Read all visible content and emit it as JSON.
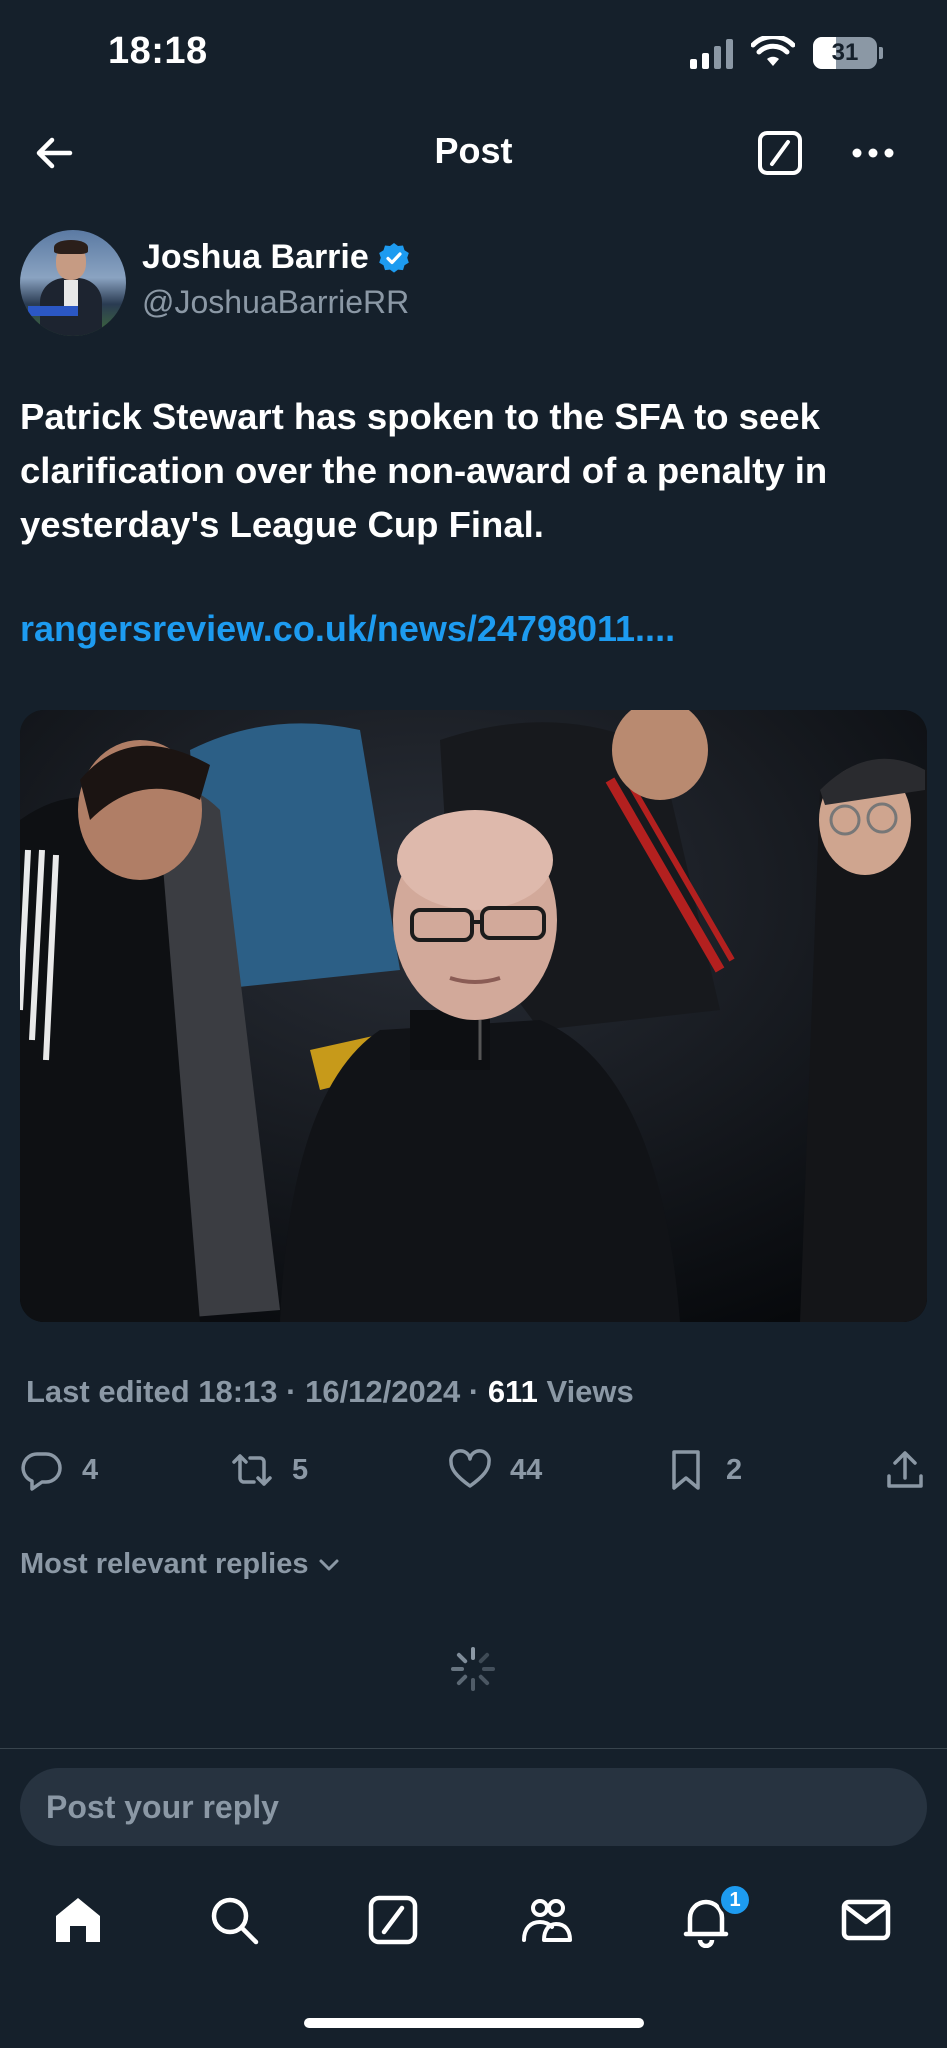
{
  "status_bar": {
    "time": "18:18",
    "battery": "31"
  },
  "header": {
    "title": "Post"
  },
  "author": {
    "name": "Joshua Barrie",
    "handle": "@JoshuaBarrieRR"
  },
  "tweet": {
    "text": "Patrick Stewart has spoken to the SFA to seek clarification over the non-award of a penalty in yesterday's League Cup Final.",
    "link": "rangersreview.co.uk/news/24798011...."
  },
  "meta": {
    "edited": "Last edited 18:13 · 16/12/2024 ·",
    "views_count": "611",
    "views_label": "Views"
  },
  "actions": {
    "replies": "4",
    "reposts": "5",
    "likes": "44",
    "bookmarks": "2"
  },
  "replies_sort": {
    "label": "Most relevant replies"
  },
  "reply_box": {
    "placeholder": "Post your reply"
  },
  "tab_bar": {
    "notifications_badge": "1"
  },
  "icons": [
    "back-arrow-icon",
    "compose-icon",
    "more-icon",
    "verified-icon",
    "reply-icon",
    "repost-icon",
    "like-icon",
    "bookmark-icon",
    "share-icon",
    "chevron-down-icon",
    "loading-spinner-icon",
    "home-icon",
    "search-icon",
    "grok-icon",
    "communities-icon",
    "bell-icon",
    "mail-icon"
  ],
  "colors": {
    "background": "#15202b",
    "accent": "#1d9bf0",
    "muted": "#8b98a5",
    "divider": "#38444d",
    "input": "#273340"
  }
}
